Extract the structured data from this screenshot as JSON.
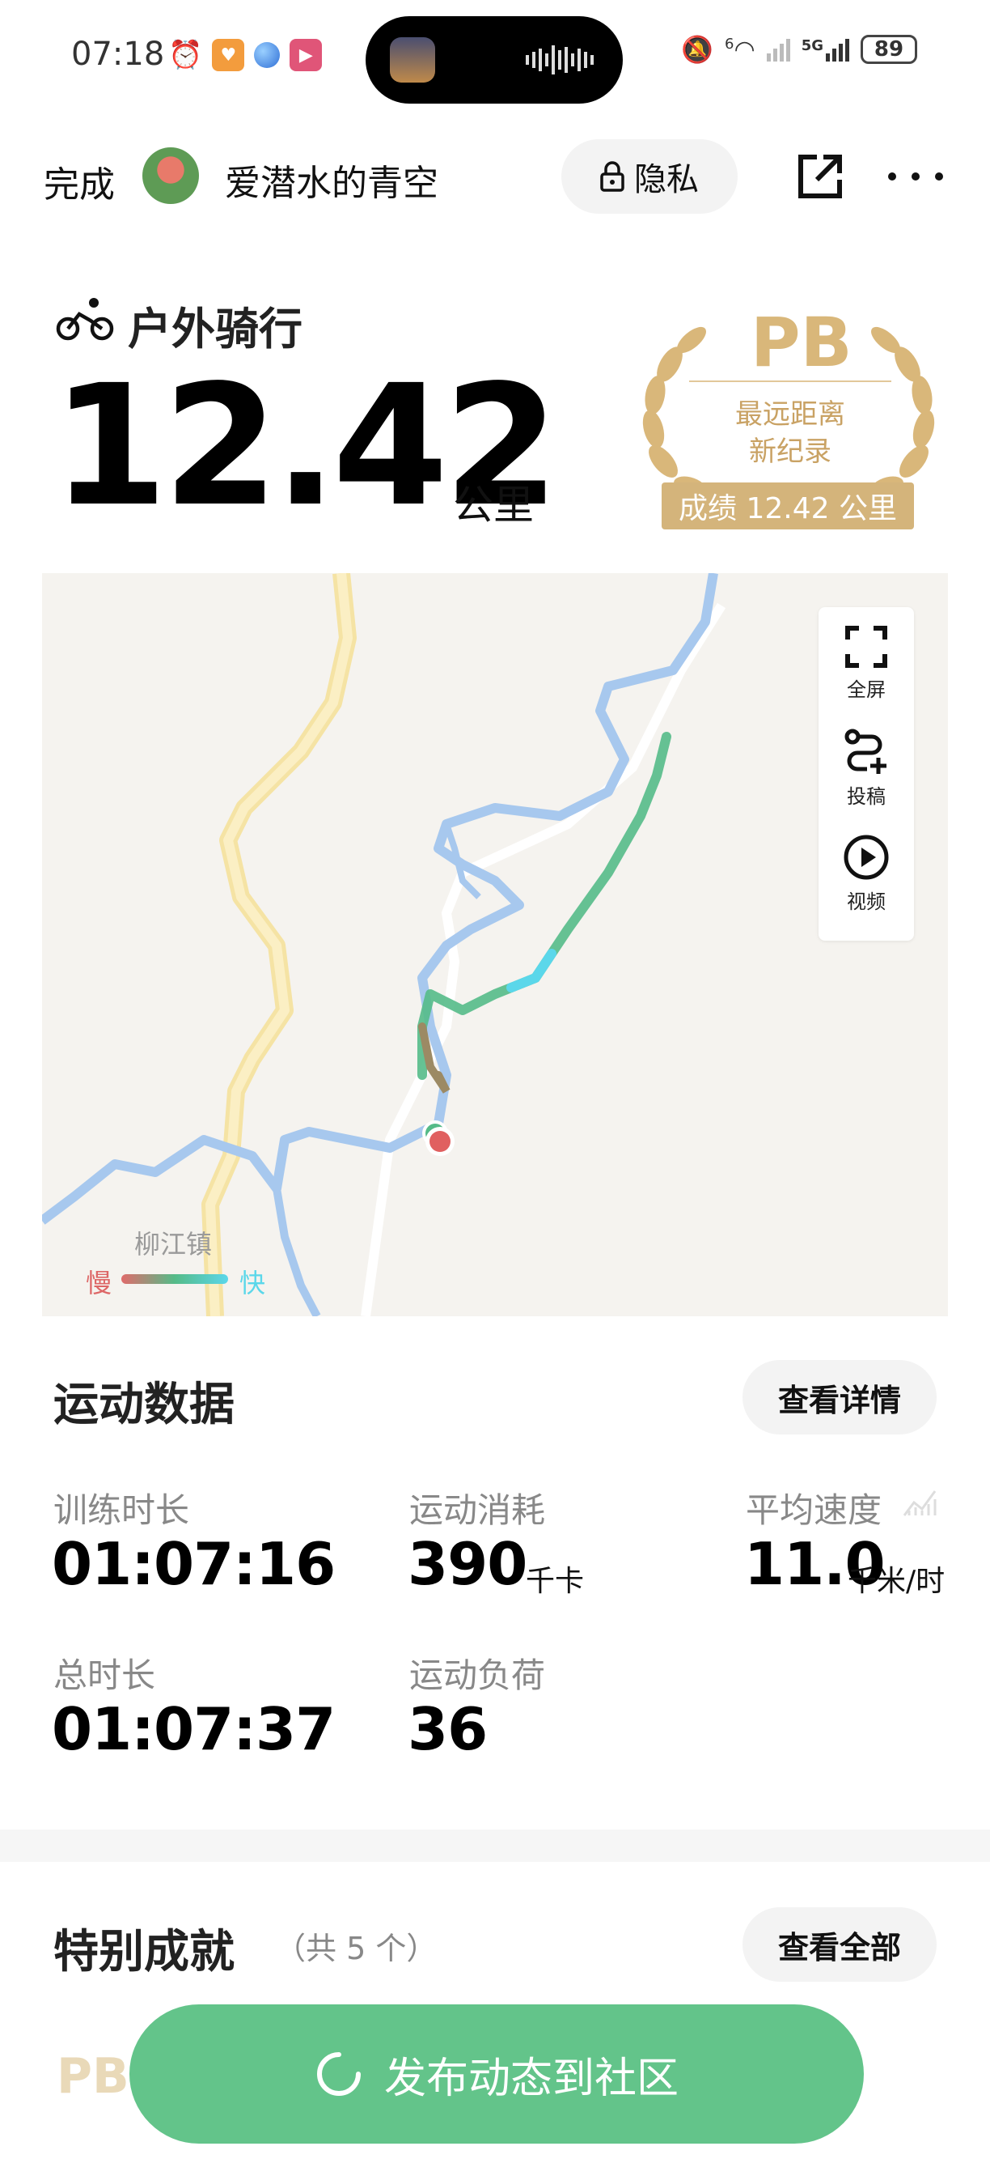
{
  "status_bar": {
    "time": "07:18",
    "signal_labels": [
      "6",
      "5G"
    ],
    "battery": "89"
  },
  "header": {
    "done_label": "完成",
    "username": "爱潜水的青空",
    "privacy_label": "隐私"
  },
  "activity": {
    "sport_type": "户外骑行",
    "distance": "12.42",
    "distance_unit": "公里"
  },
  "pb_badge": {
    "title": "PB",
    "desc_line1": "最远距离",
    "desc_line2": "新纪录",
    "score": "成绩 12.42 公里"
  },
  "map": {
    "controls": {
      "fullscreen": "全屏",
      "submit": "投稿",
      "video": "视频"
    },
    "place_label": "柳江镇",
    "legend": {
      "slow": "慢",
      "fast": "快"
    }
  },
  "exercise_data": {
    "title": "运动数据",
    "details_button": "查看详情",
    "stats": [
      {
        "label": "训练时长",
        "value": "01:07:16",
        "unit": ""
      },
      {
        "label": "运动消耗",
        "value": "390",
        "unit": "千卡"
      },
      {
        "label": "平均速度",
        "value": "11.0",
        "unit": "千米/时"
      },
      {
        "label": "总时长",
        "value": "01:07:37",
        "unit": ""
      },
      {
        "label": "运动负荷",
        "value": "36",
        "unit": ""
      }
    ]
  },
  "achievements": {
    "title": "特别成就",
    "count": "（共 5 个）",
    "view_all_button": "查看全部",
    "pb_text": "PB"
  },
  "publish_button": "发布动态到社区",
  "colors": {
    "accent_green": "#63c48a",
    "pb_gold": "#d4b47b",
    "route_green": "#55bb88",
    "route_slow": "#e06b6b",
    "route_fast": "#5bd7ea"
  }
}
